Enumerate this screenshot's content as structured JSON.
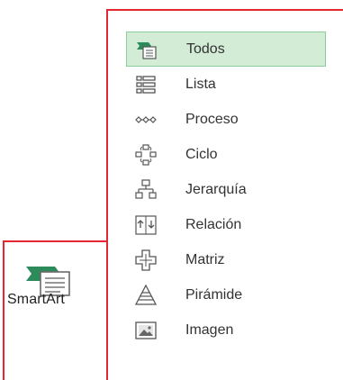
{
  "smartart": {
    "label": "SmartArt",
    "icon": "smartart-icon"
  },
  "gallery": {
    "items": [
      {
        "label": "Todos",
        "icon": "todos-icon",
        "selected": true
      },
      {
        "label": "Lista",
        "icon": "lista-icon",
        "selected": false
      },
      {
        "label": "Proceso",
        "icon": "proceso-icon",
        "selected": false
      },
      {
        "label": "Ciclo",
        "icon": "ciclo-icon",
        "selected": false
      },
      {
        "label": "Jerarquía",
        "icon": "jerarquia-icon",
        "selected": false
      },
      {
        "label": "Relación",
        "icon": "relacion-icon",
        "selected": false
      },
      {
        "label": "Matriz",
        "icon": "matriz-icon",
        "selected": false
      },
      {
        "label": "Pirámide",
        "icon": "piramide-icon",
        "selected": false
      },
      {
        "label": "Imagen",
        "icon": "imagen-icon",
        "selected": false
      }
    ]
  },
  "colors": {
    "accent_red": "#e3262f",
    "selected_bg": "#d2ecd6",
    "selected_border": "#8fcc9b",
    "icon_green": "#2d9a5a",
    "icon_gray": "#555555"
  }
}
